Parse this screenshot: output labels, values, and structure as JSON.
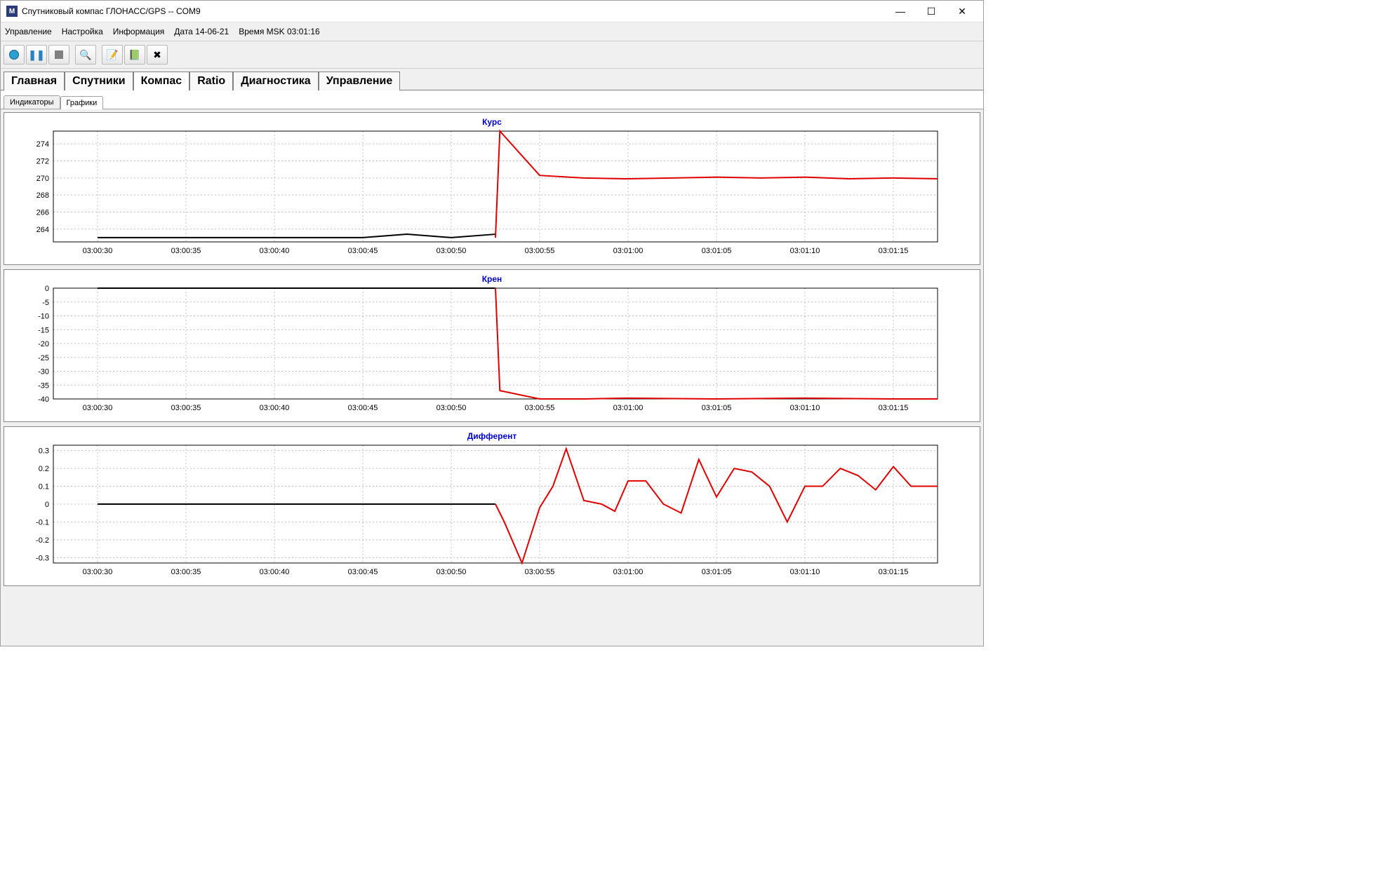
{
  "window": {
    "title": "Спутниковый компас ГЛОНАСС/GPS -- COM9",
    "icon": "M"
  },
  "menu": {
    "items": [
      "Управление",
      "Настройка",
      "Информация"
    ],
    "date_label": "Дата 14-06-21",
    "time_label": "Время MSK 03:01:16"
  },
  "toolbar": {
    "icons": [
      "record",
      "pause",
      "stop",
      "zoom",
      "edit",
      "check",
      "tools"
    ]
  },
  "tabs_main": [
    {
      "label": "Главная"
    },
    {
      "label": "Спутники"
    },
    {
      "label": "Компас",
      "active": true
    },
    {
      "label": "Ratio"
    },
    {
      "label": "Диагностика"
    },
    {
      "label": "Управление"
    }
  ],
  "tabs_sub": [
    {
      "label": "Индикаторы"
    },
    {
      "label": "Графики",
      "active": true
    }
  ],
  "chart_data": [
    {
      "title": "Курс",
      "type": "line",
      "x_categories": [
        "03:00:30",
        "03:00:35",
        "03:00:40",
        "03:00:45",
        "03:00:50",
        "03:00:55",
        "03:01:00",
        "03:01:05",
        "03:01:10",
        "03:01:15"
      ],
      "y_ticks": [
        264,
        266,
        268,
        270,
        272,
        274
      ],
      "ylim": [
        262.5,
        275.5
      ],
      "series": [
        {
          "name": "black",
          "color": "#000",
          "x": [
            0,
            1,
            2,
            3,
            3.5,
            4,
            4.5
          ],
          "values": [
            263,
            263,
            263,
            263,
            263.4,
            263,
            263.4
          ]
        },
        {
          "name": "red",
          "color": "#e00000",
          "x": [
            4.5,
            4.55,
            5,
            5.5,
            6,
            6.5,
            7,
            7.5,
            8,
            8.5,
            9,
            9.5
          ],
          "values": [
            263,
            275.5,
            270.3,
            270,
            269.9,
            270,
            270.1,
            270,
            270.1,
            269.9,
            270,
            269.9
          ]
        }
      ]
    },
    {
      "title": "Крен",
      "type": "line",
      "x_categories": [
        "03:00:30",
        "03:00:35",
        "03:00:40",
        "03:00:45",
        "03:00:50",
        "03:00:55",
        "03:01:00",
        "03:01:05",
        "03:01:10",
        "03:01:15"
      ],
      "y_ticks": [
        -40,
        -35,
        -30,
        -25,
        -20,
        -15,
        -10,
        -5,
        0
      ],
      "ylim": [
        -40,
        0
      ],
      "series": [
        {
          "name": "black",
          "color": "#000",
          "x": [
            0,
            4.5
          ],
          "values": [
            0,
            0
          ]
        },
        {
          "name": "red",
          "color": "#e00000",
          "x": [
            4.5,
            4.55,
            5,
            5.5,
            6,
            7,
            8,
            9,
            9.5
          ],
          "values": [
            0,
            -37,
            -40,
            -40,
            -39.7,
            -40,
            -39.7,
            -40,
            -40
          ]
        }
      ]
    },
    {
      "title": "Дифферент",
      "type": "line",
      "x_categories": [
        "03:00:30",
        "03:00:35",
        "03:00:40",
        "03:00:45",
        "03:00:50",
        "03:00:55",
        "03:01:00",
        "03:01:05",
        "03:01:10",
        "03:01:15"
      ],
      "y_ticks": [
        -0.3,
        -0.2,
        -0.1,
        0,
        0.1,
        0.2,
        0.3
      ],
      "ylim": [
        -0.33,
        0.33
      ],
      "series": [
        {
          "name": "black",
          "color": "#000",
          "x": [
            0,
            4.5
          ],
          "values": [
            0,
            0
          ]
        },
        {
          "name": "red",
          "color": "#e00000",
          "x": [
            4.5,
            4.6,
            4.8,
            5,
            5.15,
            5.3,
            5.5,
            5.7,
            5.85,
            6,
            6.2,
            6.4,
            6.6,
            6.8,
            7,
            7.2,
            7.4,
            7.6,
            7.8,
            8,
            8.2,
            8.4,
            8.6,
            8.8,
            9,
            9.2,
            9.5
          ],
          "values": [
            0,
            -0.1,
            -0.33,
            -0.02,
            0.1,
            0.31,
            0.02,
            0.0,
            -0.04,
            0.13,
            0.13,
            0.0,
            -0.05,
            0.25,
            0.04,
            0.2,
            0.18,
            0.1,
            -0.1,
            0.1,
            0.1,
            0.2,
            0.16,
            0.08,
            0.21,
            0.1,
            0.1
          ]
        }
      ]
    }
  ]
}
